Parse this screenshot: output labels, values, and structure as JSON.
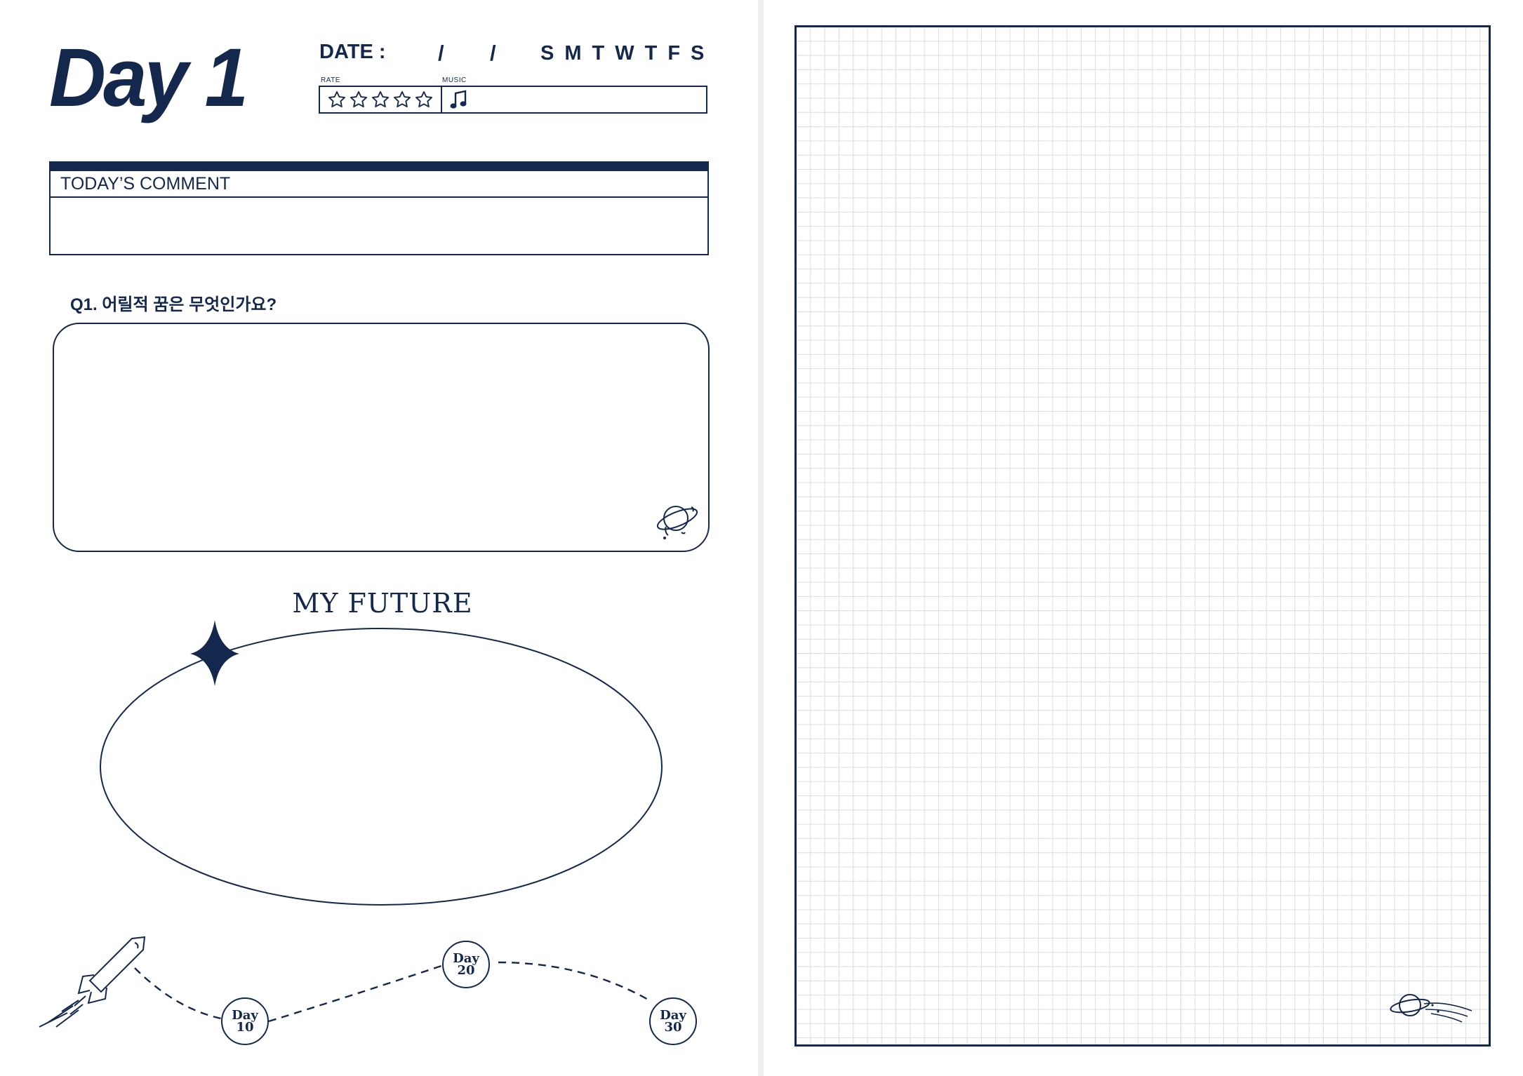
{
  "title": "Day 1",
  "date": {
    "label": "DATE :",
    "separator": "/",
    "weekdays": [
      "S",
      "M",
      "T",
      "W",
      "T",
      "F",
      "S"
    ]
  },
  "rate_label": "RATE",
  "music_label": "MUSIC",
  "rating": {
    "max": 5,
    "filled": 0
  },
  "icons": {
    "music": "music-note-icon",
    "star": "star-outline-icon",
    "sparkle": "four-point-star-icon",
    "rocket": "rocket-icon",
    "planet": "planet-icon"
  },
  "comment": {
    "header": "TODAY’S COMMENT"
  },
  "question": {
    "text": "Q1. 어릴적 꿈은 무엇인가요?"
  },
  "future": {
    "title": "MY FUTURE"
  },
  "milestones": [
    {
      "day_word": "Day",
      "number": "10"
    },
    {
      "day_word": "Day",
      "number": "20"
    },
    {
      "day_word": "Day",
      "number": "30"
    }
  ],
  "colors": {
    "navy": "#13284c",
    "grid": "#d8dce3"
  }
}
